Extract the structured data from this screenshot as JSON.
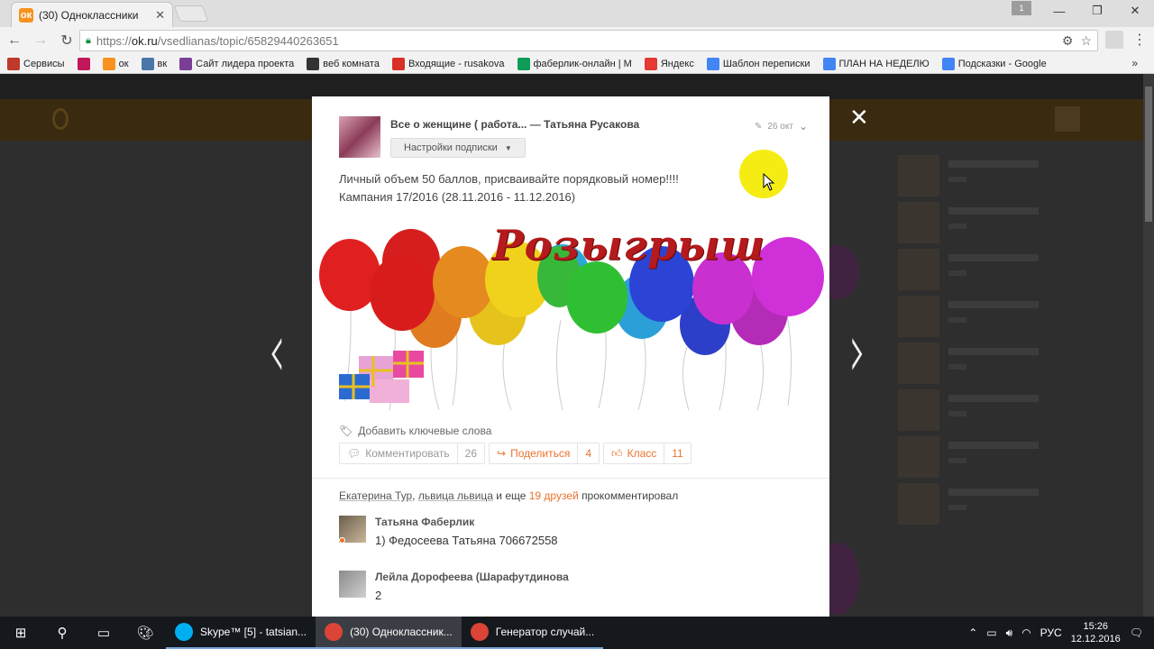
{
  "browser": {
    "tab_title": "(30) Одноклассники",
    "tab_favicon": "ok-icon",
    "url_scheme": "https://",
    "url_host": "ok.ru",
    "url_path": "/vsedlianas/topic/65829440263651",
    "profile_badge": "1",
    "bookmarks": [
      {
        "label": "Сервисы",
        "icon": "apps-icon",
        "color": "#c0392b"
      },
      {
        "label": "",
        "icon": "fl-icon",
        "color": "#c2185b"
      },
      {
        "label": "ок",
        "icon": "ok-icon",
        "color": "#f7931e"
      },
      {
        "label": "вк",
        "icon": "vk-icon",
        "color": "#4a76a8"
      },
      {
        "label": "Сайт лидера проекта",
        "icon": "site-icon",
        "color": "#7b3f98"
      },
      {
        "label": "веб комната",
        "icon": "web-room-icon",
        "color": "#333333"
      },
      {
        "label": "Входящие - rusakova",
        "icon": "gmail-icon",
        "color": "#d93025"
      },
      {
        "label": "фаберлик-онлайн | М",
        "icon": "chat-icon",
        "color": "#0f9d58"
      },
      {
        "label": "Яндекс",
        "icon": "yandex-icon",
        "color": "#e53935"
      },
      {
        "label": "Шаблон переписки",
        "icon": "doc-icon",
        "color": "#4285f4"
      },
      {
        "label": "ПЛАН НА НЕДЕЛЮ",
        "icon": "doc-icon",
        "color": "#4285f4"
      },
      {
        "label": "Подсказки - Google",
        "icon": "doc-icon",
        "color": "#4285f4"
      }
    ]
  },
  "post": {
    "group": "Все о женщине ( работа...",
    "author": "Татьяна Русакова",
    "subscription_button": "Настройки подписки",
    "date": "26 окт",
    "text_line1": "Личный объем 50 баллов, присваивайте порядковый номер!!!!",
    "text_line2": "Кампания 17/2016 (28.11.2016 - 11.12.2016)",
    "banner_word": "Розыгрыш",
    "add_keywords": "Добавить ключевые слова",
    "actions": {
      "comment_label": "Комментировать",
      "comment_count": "26",
      "share_label": "Поделиться",
      "share_count": "4",
      "like_label": "Класс",
      "like_count": "11"
    }
  },
  "activity": {
    "name1": "Екатерина Тур",
    "name2": "львица львица",
    "mid": "и еще",
    "friends": "19 друзей",
    "tail": "прокомментировал"
  },
  "comments": [
    {
      "name": "Татьяна Фаберлик",
      "text": "1) Федосеева Татьяна 706672558"
    },
    {
      "name": "Лейла Дорофеева (Шарафутдинова",
      "text": "2"
    }
  ],
  "taskbar": {
    "apps": [
      {
        "label": "Skype™ [5] - tatsian...",
        "icon": "skype-icon",
        "color": "#00aff0"
      },
      {
        "label": "(30) Одноклассник...",
        "icon": "chrome-icon",
        "color": "#db4437"
      },
      {
        "label": "Генератор случай...",
        "icon": "chrome-icon",
        "color": "#db4437"
      }
    ],
    "lang": "РУС",
    "time": "15:26",
    "date": "12.12.2016"
  },
  "colors": {
    "ok_orange": "#eb722e",
    "banner_red": "#b51a1c",
    "cursor_highlight": "#f5ec14"
  }
}
